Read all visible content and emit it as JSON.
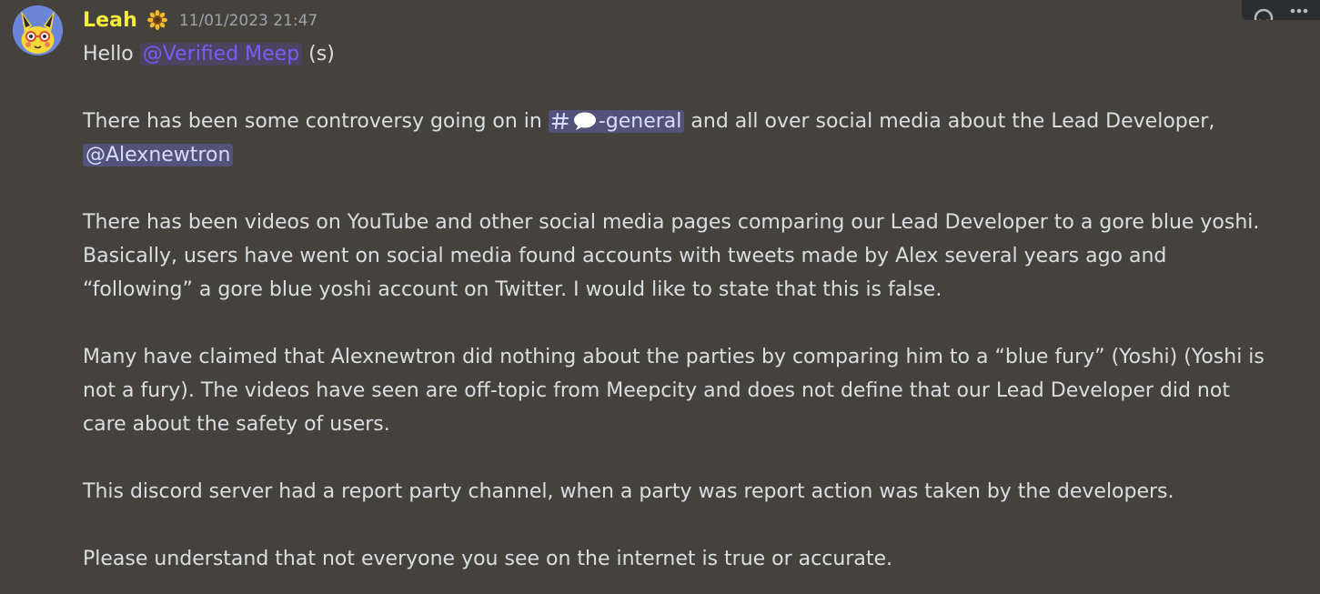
{
  "message": {
    "author": "Leah",
    "role_icon": "sunflower-icon",
    "timestamp": "11/01/2023 21:47",
    "role_mention": "@Verified Meep",
    "greeting_prefix": "Hello ",
    "greeting_suffix": " (s)",
    "p2_before": "There has been some controversy going on in ",
    "channel_mention": "-general",
    "p2_after": " and all over social media about the Lead Developer, ",
    "user_mention": "@Alexnewtron",
    "p3": "There has been videos on YouTube and other social media pages comparing our Lead Developer to a gore blue yoshi. Basically, users have went on social media found accounts with tweets made by Alex several years ago and “following” a gore blue yoshi account on Twitter. I would like to state that this is false.",
    "p4": "Many have claimed that Alexnewtron did nothing about the parties by comparing him to a “blue fury” (Yoshi) (Yoshi is not a fury).  The videos have seen are off-topic from Meepcity and does not define that our Lead Developer did not care about the safety of users.",
    "p5": "This discord server had a report party channel, when a party was report action was taken by the developers.",
    "p6": "Please understand that not everyone you see on the internet is true or accurate."
  },
  "colors": {
    "background": "#45423d",
    "username": "#f5ef39",
    "role_mention": "#7a5df5",
    "mention_text": "#d6dcff",
    "mention_bg": "#52527a"
  },
  "toolbar": {
    "icons": [
      "add-reaction-icon",
      "more-options-icon"
    ]
  }
}
